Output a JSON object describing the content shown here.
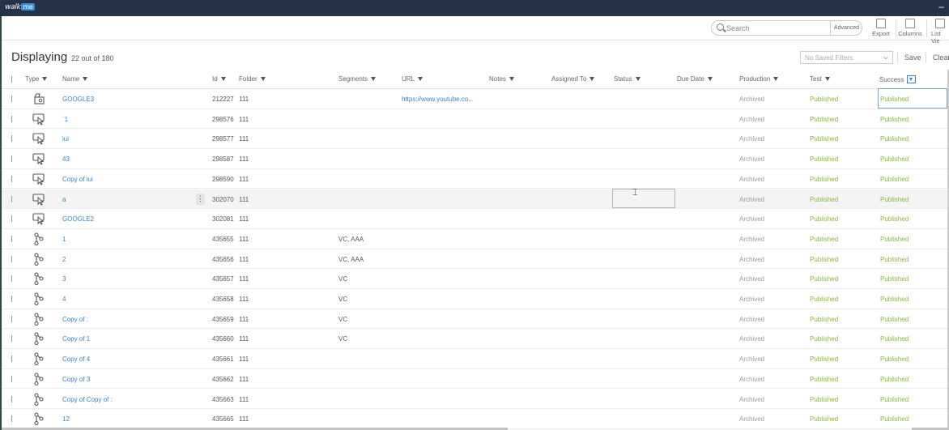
{
  "app": {
    "logo_text": "walk",
    "logo_badge": "me",
    "minimize": "–"
  },
  "toolbar": {
    "search_placeholder": "Search",
    "advanced_label": "Advanced",
    "export_label": "Export",
    "columns_label": "Columns",
    "list_view_label": "List Vie"
  },
  "summary": {
    "title": "Displaying",
    "count": "22 out of 180"
  },
  "filters": {
    "placeholder": "No Saved Filters",
    "save_label": "Save",
    "clear_label": "Clear"
  },
  "columns": [
    "Type",
    "Name",
    "Id",
    "Folder",
    "Segments",
    "URL",
    "Notes",
    "Assigned To",
    "Status",
    "Due Date",
    "Production",
    "Test",
    "Success"
  ],
  "rows": [
    {
      "type": "shoutout-icon",
      "name": "GOOGLE3",
      "id": "212227",
      "folder": "111",
      "segments": "",
      "url": "https://www.youtube.co...",
      "production": "Archived",
      "test": "Published",
      "success": "Published"
    },
    {
      "type": "smarttip-icon",
      "name": "`1",
      "id": "298576",
      "folder": "111",
      "segments": "",
      "url": "",
      "production": "Archived",
      "test": "Published",
      "success": "Published"
    },
    {
      "type": "smarttip-icon",
      "name": "iui",
      "id": "298577",
      "folder": "111",
      "segments": "",
      "url": "",
      "production": "Archived",
      "test": "Published",
      "success": "Published"
    },
    {
      "type": "smarttip-icon",
      "name": "43",
      "id": "298587",
      "folder": "111",
      "segments": "",
      "url": "",
      "production": "Archived",
      "test": "Published",
      "success": "Published"
    },
    {
      "type": "smarttip-icon",
      "name": "Copy of iui",
      "id": "298590",
      "folder": "111",
      "segments": "",
      "url": "",
      "production": "Archived",
      "test": "Published",
      "success": "Published"
    },
    {
      "type": "smarttip-icon",
      "name": "a",
      "id": "302070",
      "folder": "111",
      "segments": "",
      "url": "",
      "production": "Archived",
      "test": "Published",
      "success": "Published"
    },
    {
      "type": "smarttip-icon",
      "name": "GOOGLE2",
      "id": "302081",
      "folder": "111",
      "segments": "",
      "url": "",
      "production": "Archived",
      "test": "Published",
      "success": "Published"
    },
    {
      "type": "flow-icon",
      "name": "1",
      "id": "435655",
      "folder": "111",
      "segments": "VC, AAA",
      "url": "",
      "production": "Archived",
      "test": "Published",
      "success": "Published"
    },
    {
      "type": "flow-icon",
      "name": "2",
      "id": "435656",
      "folder": "111",
      "segments": "VC, AAA",
      "url": "",
      "production": "Archived",
      "test": "Published",
      "success": "Published"
    },
    {
      "type": "flow-icon",
      "name": "3",
      "id": "435657",
      "folder": "111",
      "segments": "VC",
      "url": "",
      "production": "Archived",
      "test": "Published",
      "success": "Published"
    },
    {
      "type": "flow-icon",
      "name": "4",
      "id": "435658",
      "folder": "111",
      "segments": "VC",
      "url": "",
      "production": "Archived",
      "test": "Published",
      "success": "Published"
    },
    {
      "type": "flow-icon",
      "name": "Copy of :",
      "id": "435659",
      "folder": "111",
      "segments": "VC",
      "url": "",
      "production": "Archived",
      "test": "Published",
      "success": "Published"
    },
    {
      "type": "flow-icon",
      "name": "Copy of 1",
      "id": "435660",
      "folder": "111",
      "segments": "VC",
      "url": "",
      "production": "Archived",
      "test": "Published",
      "success": "Published"
    },
    {
      "type": "flow-icon",
      "name": "Copy of 4",
      "id": "435661",
      "folder": "111",
      "segments": "",
      "url": "",
      "production": "Archived",
      "test": "Published",
      "success": "Published"
    },
    {
      "type": "flow-icon",
      "name": "Copy of 3",
      "id": "435662",
      "folder": "111",
      "segments": "",
      "url": "",
      "production": "Archived",
      "test": "Published",
      "success": "Published"
    },
    {
      "type": "flow-icon",
      "name": "Copy of Copy of :",
      "id": "435663",
      "folder": "111",
      "segments": "",
      "url": "",
      "production": "Archived",
      "test": "Published",
      "success": "Published"
    },
    {
      "type": "flow-icon",
      "name": "12",
      "id": "435665",
      "folder": "111",
      "segments": "",
      "url": "",
      "production": "Archived",
      "test": "Published",
      "success": "Published"
    }
  ],
  "colors": {
    "link": "#3d83c4",
    "published": "#8ab43c",
    "archived": "#9a9a9a",
    "titlebar": "#233246"
  }
}
